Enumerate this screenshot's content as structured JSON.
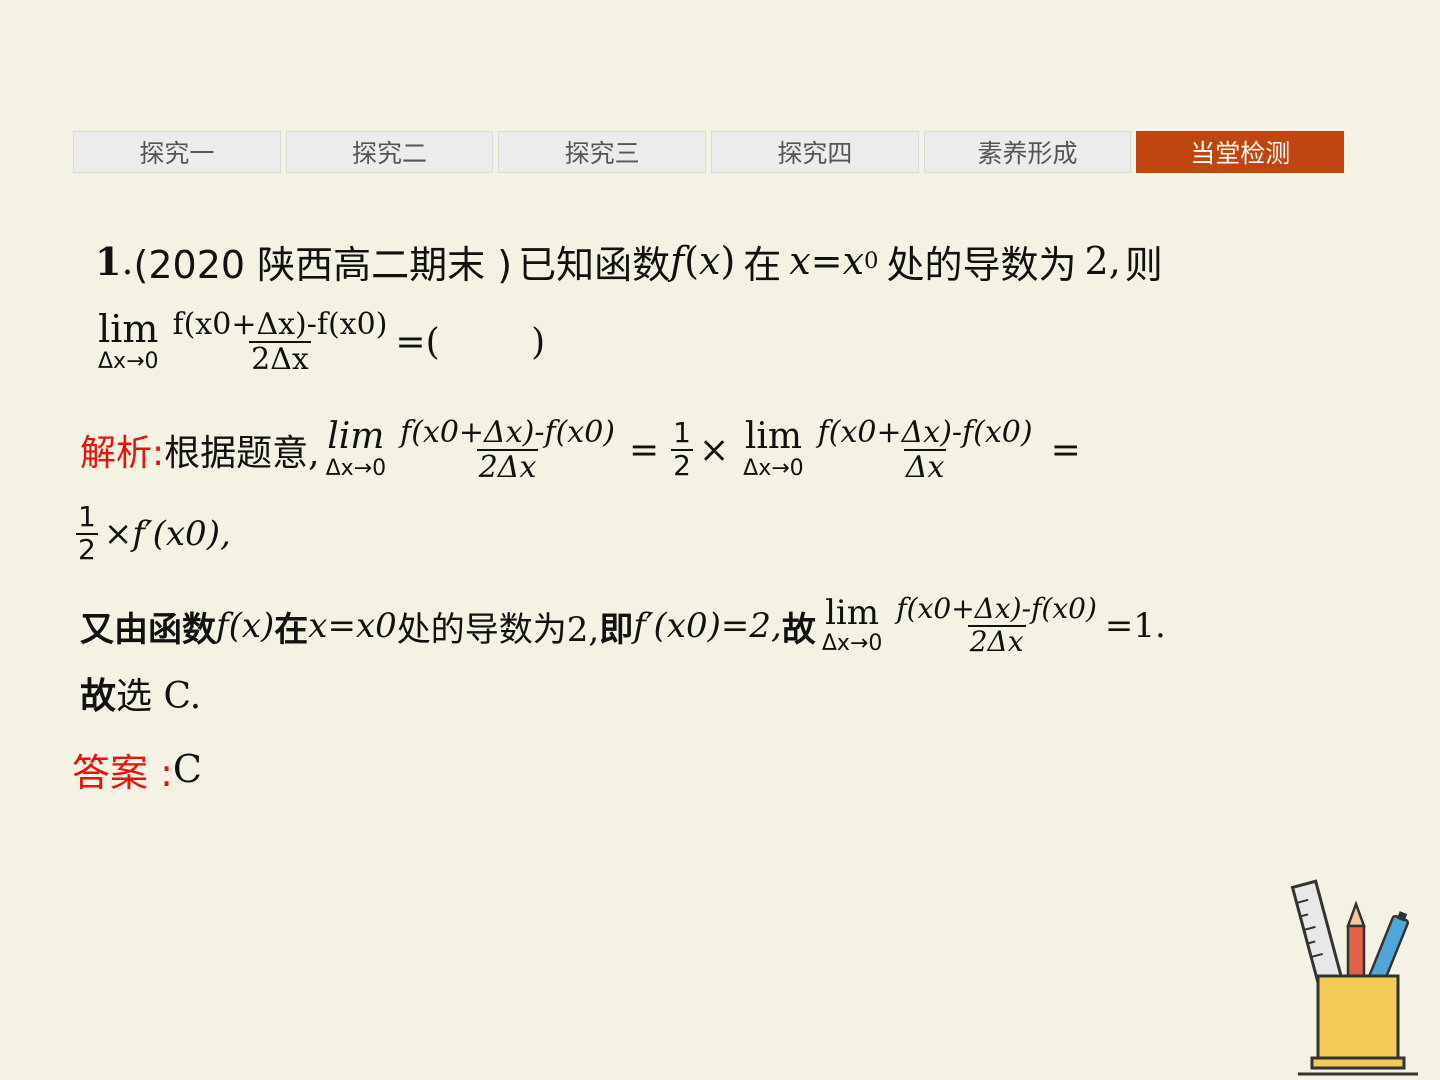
{
  "tabs": [
    {
      "label": "探究一"
    },
    {
      "label": "探究二"
    },
    {
      "label": "探究三"
    },
    {
      "label": "探究四"
    },
    {
      "label": "素养形成"
    },
    {
      "label": "当堂检测"
    }
  ],
  "question": {
    "number": "1",
    "dot": ".",
    "source": "(2020 陕西高二期末 )",
    "text_1": "已知函数",
    "fx": "f",
    "x_paren_open": "(",
    "x_var": "x",
    "x_paren_close": ")",
    "text_2": "在",
    "cond_x": "x",
    "cond_eq": "=",
    "cond_x0": "x",
    "cond_sub": "0",
    "text_3": "处的导数为",
    "value": "2,",
    "text_4": "则",
    "lim_word": "lim",
    "lim_under": "Δx→0",
    "frac_num": "f(x0+Δx)-f(x0)",
    "frac_den": "2Δx",
    "tail": "=(        )"
  },
  "solution": {
    "label": "解析:",
    "intro": "根据题意,",
    "lim1_word": "lim",
    "lim1_under": "Δx→0",
    "frac1_num": "f(x0+Δx)-f(x0)",
    "frac1_den": "2Δx",
    "eq1": "=",
    "half_num": "1",
    "half_den": "2",
    "times": "×",
    "lim2_word": "lim",
    "lim2_under": "Δx→0",
    "frac2_num": "f(x0+Δx)-f(x0)",
    "frac2_den": "Δx",
    "eq2": "=",
    "line2_half_num": "1",
    "line2_half_den": "2",
    "line2_rest": "×f′(x0),",
    "line3_a": "又由函数",
    "line3_fx": "f(x)",
    "line3_b": "在",
    "line3_cond": "x=x0",
    "line3_c": "处的导数为2,",
    "line3_d": "即",
    "line3_deriv": "f′(x0)=2,",
    "line3_e": "故",
    "lim3_word": "lim",
    "lim3_under": "Δx→0",
    "frac3_num": "f(x0+Δx)-f(x0)",
    "frac3_den": "2Δx",
    "line3_tail": "=1.",
    "line4_a": "故",
    "line4_b": "选 C."
  },
  "answer": {
    "label": "答案 :",
    "value": "C"
  },
  "icon": {
    "name": "pencil-cup-icon"
  },
  "colors": {
    "background": "#f4f2e2",
    "tab_active": "#c0450e",
    "tab_inactive": "#ececec",
    "accent_red": "#e3140f",
    "cup_yellow": "#f4cc55"
  }
}
